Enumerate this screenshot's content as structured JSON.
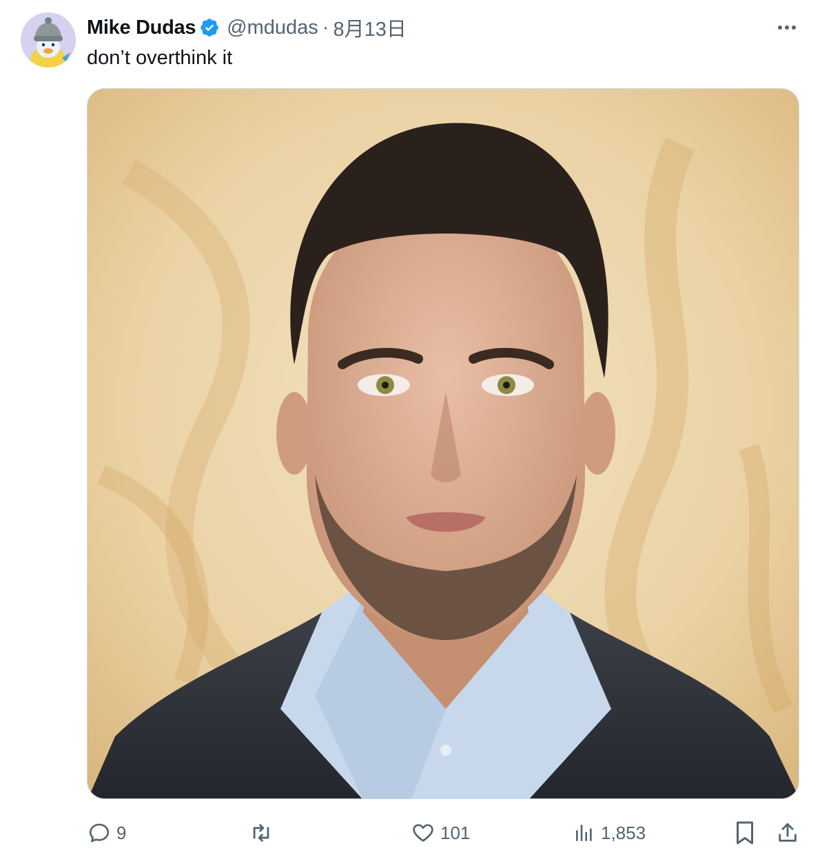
{
  "tweet": {
    "author_name": "Mike Dudas",
    "handle": "@mdudas",
    "separator": "·",
    "date": "8月13日",
    "text": "don’t overthink it",
    "avatar_icon": "penguin-avatar-icon",
    "media_icon": "portrait-photo"
  },
  "actions": {
    "replies": "9",
    "reposts": "",
    "likes": "101",
    "views": "1,853"
  },
  "colors": {
    "verified": "#1d9bf0",
    "muted_text": "#536471",
    "primary_text": "#0f1419",
    "border": "#cfd9de"
  }
}
